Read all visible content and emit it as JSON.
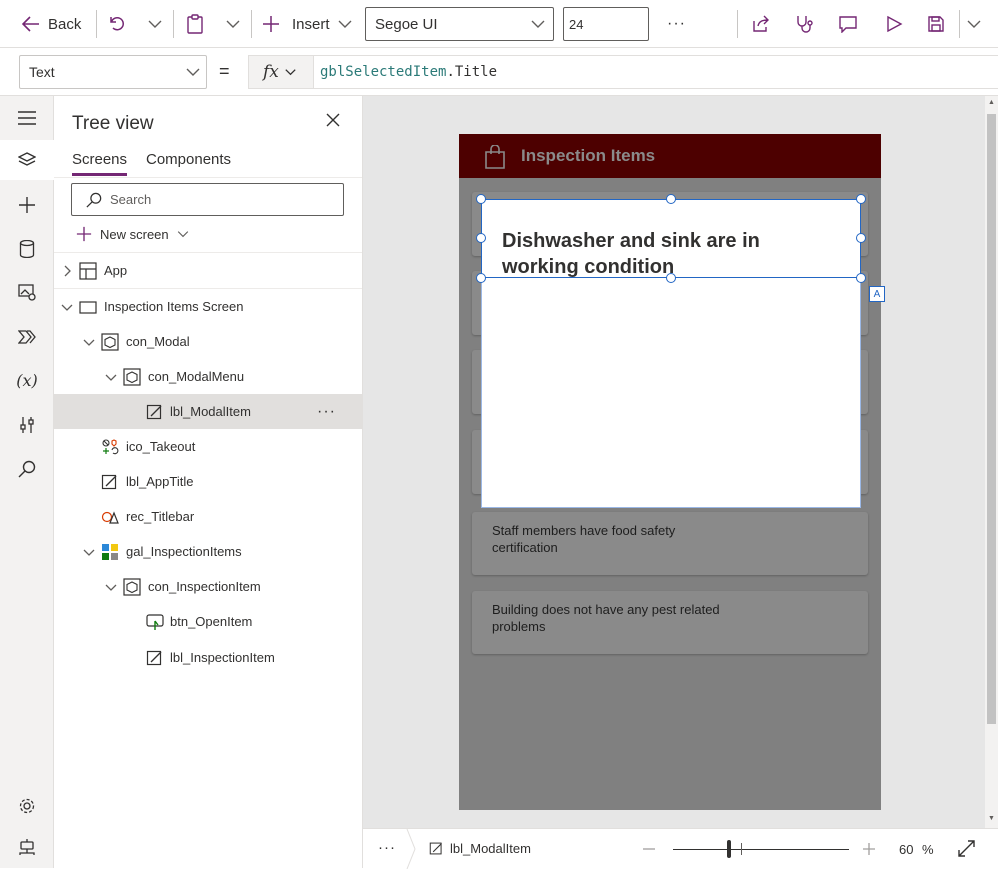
{
  "toolbar": {
    "back_label": "Back",
    "insert_label": "Insert",
    "font_name": "Segoe UI",
    "font_size": "24",
    "more_label": "···"
  },
  "formula_bar": {
    "property": "Text",
    "equals": "=",
    "fx_label": "fx",
    "formula_var": "gblSelectedItem",
    "formula_rest": ".Title"
  },
  "tree": {
    "title": "Tree view",
    "tabs": [
      "Screens",
      "Components"
    ],
    "active_tab": "Screens",
    "search_placeholder": "Search",
    "new_screen_label": "New screen",
    "nodes": [
      {
        "label": "App",
        "icon": "app-icon"
      },
      {
        "label": "Inspection Items Screen",
        "icon": "screen-icon"
      },
      {
        "label": "con_Modal",
        "icon": "container-icon"
      },
      {
        "label": "con_ModalMenu",
        "icon": "container-icon"
      },
      {
        "label": "lbl_ModalItem",
        "icon": "label-icon",
        "selected": true
      },
      {
        "label": "ico_Takeout",
        "icon": "icons-icon"
      },
      {
        "label": "lbl_AppTitle",
        "icon": "label-icon"
      },
      {
        "label": "rec_Titlebar",
        "icon": "shape-icon"
      },
      {
        "label": "gal_InspectionItems",
        "icon": "gallery-icon"
      },
      {
        "label": "con_InspectionItem",
        "icon": "container-icon"
      },
      {
        "label": "btn_OpenItem",
        "icon": "button-icon"
      },
      {
        "label": "lbl_InspectionItem",
        "icon": "label-icon"
      }
    ],
    "node_more": "···"
  },
  "app": {
    "title": "Inspection Items",
    "modal_text": "Dishwasher and sink are in working condition",
    "badge": "A",
    "items": [
      "",
      "",
      "",
      "",
      "Staff members have food safety certification",
      "Building does not have any pest related problems"
    ]
  },
  "status_bar": {
    "more_label": "···",
    "selected_control": "lbl_ModalItem",
    "zoom_value": "60",
    "zoom_unit": "%"
  },
  "colors": {
    "accent": "#742774",
    "titlebar": "#4d0000",
    "selection": "#2266c4"
  }
}
